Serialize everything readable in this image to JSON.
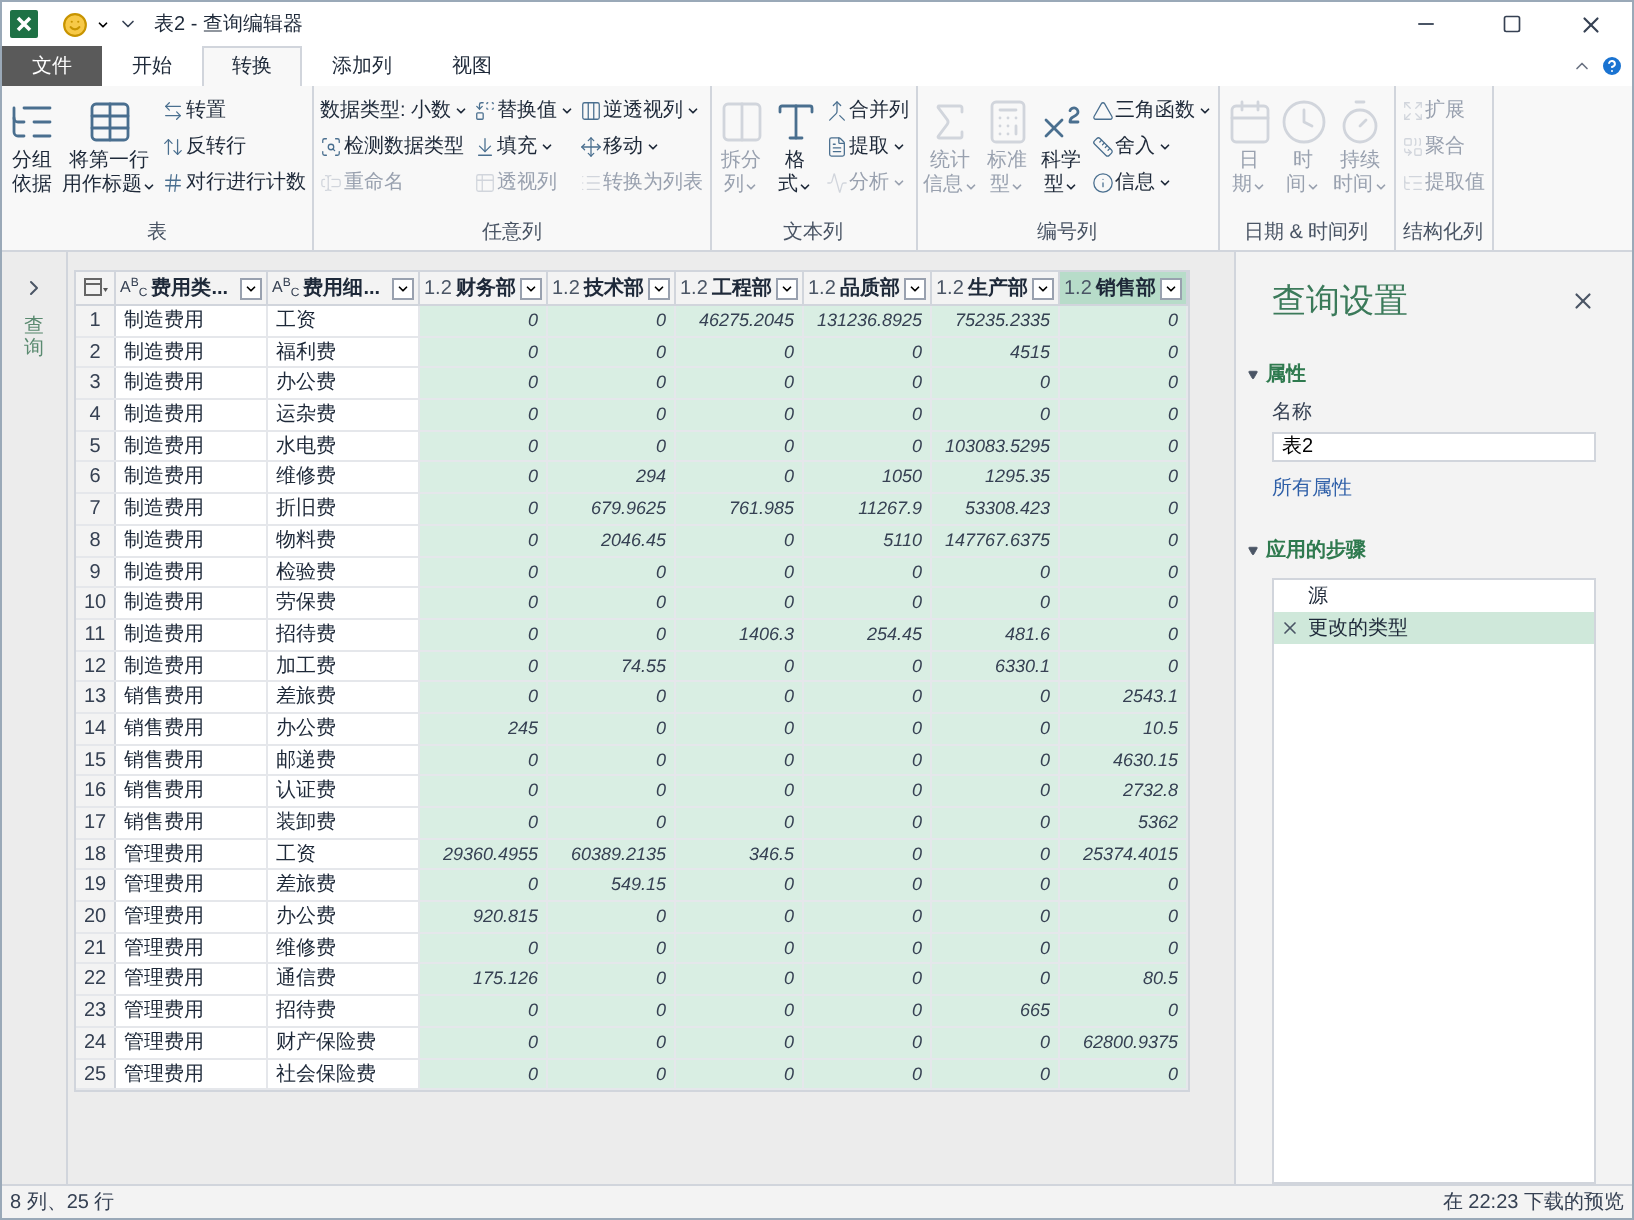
{
  "window": {
    "title": "表2 - 查询编辑器"
  },
  "menu_tabs": [
    {
      "label": "文件",
      "kind": "file",
      "selected": false
    },
    {
      "label": "开始",
      "kind": "tab",
      "selected": false
    },
    {
      "label": "转换",
      "kind": "tab",
      "selected": true
    },
    {
      "label": "添加列",
      "kind": "tab",
      "selected": false
    },
    {
      "label": "视图",
      "kind": "tab",
      "selected": false
    }
  ],
  "ribbon": [
    {
      "label": "表",
      "columns": [
        {
          "kind": "large",
          "lines": [
            "分组",
            "依据"
          ],
          "dropdown": false,
          "disabled": false
        },
        {
          "kind": "large",
          "lines": [
            "将第一行",
            "用作标题"
          ],
          "dropdown": true,
          "disabled": false
        },
        {
          "kind": "stack",
          "buttons": [
            {
              "label": "转置",
              "dropdown": false,
              "disabled": false
            },
            {
              "label": "反转行",
              "dropdown": false,
              "disabled": false
            },
            {
              "label": "对行进行计数",
              "dropdown": false,
              "disabled": false
            }
          ]
        }
      ]
    },
    {
      "label": "任意列",
      "columns": [
        {
          "kind": "stack",
          "buttons": [
            {
              "label": "数据类型: 小数",
              "dropdown": true,
              "disabled": false
            },
            {
              "label": "检测数据类型",
              "dropdown": false,
              "disabled": false
            },
            {
              "label": "重命名",
              "dropdown": false,
              "disabled": true
            }
          ]
        },
        {
          "kind": "stack",
          "buttons": [
            {
              "label": "替换值",
              "dropdown": true,
              "disabled": false
            },
            {
              "label": "填充",
              "dropdown": true,
              "disabled": false
            },
            {
              "label": "透视列",
              "dropdown": false,
              "disabled": true
            }
          ]
        },
        {
          "kind": "stack",
          "buttons": [
            {
              "label": "逆透视列",
              "dropdown": true,
              "disabled": false
            },
            {
              "label": "移动",
              "dropdown": true,
              "disabled": false
            },
            {
              "label": "转换为列表",
              "dropdown": false,
              "disabled": true
            }
          ]
        }
      ]
    },
    {
      "label": "文本列",
      "columns": [
        {
          "kind": "large",
          "lines": [
            "拆分",
            "列"
          ],
          "dropdown": true,
          "disabled": true
        },
        {
          "kind": "large",
          "lines": [
            "格",
            "式"
          ],
          "dropdown": true,
          "disabled": false
        },
        {
          "kind": "stack",
          "buttons": [
            {
              "label": "合并列",
              "dropdown": false,
              "disabled": false
            },
            {
              "label": "提取",
              "dropdown": true,
              "disabled": false
            },
            {
              "label": "分析",
              "dropdown": true,
              "disabled": true
            }
          ]
        }
      ]
    },
    {
      "label": "编号列",
      "columns": [
        {
          "kind": "large",
          "lines": [
            "统计",
            "信息"
          ],
          "dropdown": true,
          "disabled": true
        },
        {
          "kind": "large",
          "lines": [
            "标准",
            "型"
          ],
          "dropdown": true,
          "disabled": true
        },
        {
          "kind": "large",
          "lines": [
            "科学",
            "型"
          ],
          "dropdown": true,
          "disabled": false
        },
        {
          "kind": "stack",
          "buttons": [
            {
              "label": "三角函数",
              "dropdown": true,
              "disabled": false
            },
            {
              "label": "舍入",
              "dropdown": true,
              "disabled": false
            },
            {
              "label": "信息",
              "dropdown": true,
              "disabled": false
            }
          ]
        }
      ]
    },
    {
      "label": "日期 & 时间列",
      "columns": [
        {
          "kind": "large",
          "lines": [
            "日",
            "期"
          ],
          "dropdown": true,
          "disabled": true
        },
        {
          "kind": "large",
          "lines": [
            "时",
            "间"
          ],
          "dropdown": true,
          "disabled": true
        },
        {
          "kind": "large",
          "lines": [
            "持续",
            "时间"
          ],
          "dropdown": true,
          "disabled": true
        }
      ]
    },
    {
      "label": "结构化列",
      "columns": [
        {
          "kind": "stack",
          "buttons": [
            {
              "label": "扩展",
              "dropdown": false,
              "disabled": true
            },
            {
              "label": "聚合",
              "dropdown": false,
              "disabled": true
            },
            {
              "label": "提取值",
              "dropdown": false,
              "disabled": true
            }
          ]
        }
      ]
    }
  ],
  "navigator": {
    "label": "查询"
  },
  "table": {
    "columns": [
      {
        "name": "费用类...",
        "kind": "text",
        "type_label": "A$^{B}$$_{C}$",
        "selected": false
      },
      {
        "name": "费用细...",
        "kind": "text",
        "type_label": "A$^{B}$$_{C}$",
        "selected": false
      },
      {
        "name": "财务部",
        "kind": "decimal",
        "type_label": "1.2",
        "selected": false
      },
      {
        "name": "技术部",
        "kind": "decimal",
        "type_label": "1.2",
        "selected": false
      },
      {
        "name": "工程部",
        "kind": "decimal",
        "type_label": "1.2",
        "selected": false
      },
      {
        "name": "品质部",
        "kind": "decimal",
        "type_label": "1.2",
        "selected": false
      },
      {
        "name": "生产部",
        "kind": "decimal",
        "type_label": "1.2",
        "selected": false
      },
      {
        "name": "销售部",
        "kind": "decimal",
        "type_label": "1.2",
        "selected": true
      }
    ],
    "rows": [
      {
        "num": "1",
        "cells": [
          "制造费用",
          "工资",
          "0",
          "0",
          "46275.2045",
          "131236.8925",
          "75235.2335",
          "0"
        ]
      },
      {
        "num": "2",
        "cells": [
          "制造费用",
          "福利费",
          "0",
          "0",
          "0",
          "0",
          "4515",
          "0"
        ]
      },
      {
        "num": "3",
        "cells": [
          "制造费用",
          "办公费",
          "0",
          "0",
          "0",
          "0",
          "0",
          "0"
        ]
      },
      {
        "num": "4",
        "cells": [
          "制造费用",
          "运杂费",
          "0",
          "0",
          "0",
          "0",
          "0",
          "0"
        ]
      },
      {
        "num": "5",
        "cells": [
          "制造费用",
          "水电费",
          "0",
          "0",
          "0",
          "0",
          "103083.5295",
          "0"
        ]
      },
      {
        "num": "6",
        "cells": [
          "制造费用",
          "维修费",
          "0",
          "294",
          "0",
          "1050",
          "1295.35",
          "0"
        ]
      },
      {
        "num": "7",
        "cells": [
          "制造费用",
          "折旧费",
          "0",
          "679.9625",
          "761.985",
          "11267.9",
          "53308.423",
          "0"
        ]
      },
      {
        "num": "8",
        "cells": [
          "制造费用",
          "物料费",
          "0",
          "2046.45",
          "0",
          "5110",
          "147767.6375",
          "0"
        ]
      },
      {
        "num": "9",
        "cells": [
          "制造费用",
          "检验费",
          "0",
          "0",
          "0",
          "0",
          "0",
          "0"
        ]
      },
      {
        "num": "10",
        "cells": [
          "制造费用",
          "劳保费",
          "0",
          "0",
          "0",
          "0",
          "0",
          "0"
        ]
      },
      {
        "num": "11",
        "cells": [
          "制造费用",
          "招待费",
          "0",
          "0",
          "1406.3",
          "254.45",
          "481.6",
          "0"
        ]
      },
      {
        "num": "12",
        "cells": [
          "制造费用",
          "加工费",
          "0",
          "74.55",
          "0",
          "0",
          "6330.1",
          "0"
        ]
      },
      {
        "num": "13",
        "cells": [
          "销售费用",
          "差旅费",
          "0",
          "0",
          "0",
          "0",
          "0",
          "2543.1"
        ]
      },
      {
        "num": "14",
        "cells": [
          "销售费用",
          "办公费",
          "245",
          "0",
          "0",
          "0",
          "0",
          "10.5"
        ]
      },
      {
        "num": "15",
        "cells": [
          "销售费用",
          "邮递费",
          "0",
          "0",
          "0",
          "0",
          "0",
          "4630.15"
        ]
      },
      {
        "num": "16",
        "cells": [
          "销售费用",
          "认证费",
          "0",
          "0",
          "0",
          "0",
          "0",
          "2732.8"
        ]
      },
      {
        "num": "17",
        "cells": [
          "销售费用",
          "装卸费",
          "0",
          "0",
          "0",
          "0",
          "0",
          "5362"
        ]
      },
      {
        "num": "18",
        "cells": [
          "管理费用",
          "工资",
          "29360.4955",
          "60389.2135",
          "346.5",
          "0",
          "0",
          "25374.4015"
        ]
      },
      {
        "num": "19",
        "cells": [
          "管理费用",
          "差旅费",
          "0",
          "549.15",
          "0",
          "0",
          "0",
          "0"
        ]
      },
      {
        "num": "20",
        "cells": [
          "管理费用",
          "办公费",
          "920.815",
          "0",
          "0",
          "0",
          "0",
          "0"
        ]
      },
      {
        "num": "21",
        "cells": [
          "管理费用",
          "维修费",
          "0",
          "0",
          "0",
          "0",
          "0",
          "0"
        ]
      },
      {
        "num": "22",
        "cells": [
          "管理费用",
          "通信费",
          "175.126",
          "0",
          "0",
          "0",
          "0",
          "80.5"
        ]
      },
      {
        "num": "23",
        "cells": [
          "管理费用",
          "招待费",
          "0",
          "0",
          "0",
          "0",
          "665",
          "0"
        ]
      },
      {
        "num": "24",
        "cells": [
          "管理费用",
          "财产保险费",
          "0",
          "0",
          "0",
          "0",
          "0",
          "62800.9375"
        ]
      },
      {
        "num": "25",
        "cells": [
          "管理费用",
          "社会保险费",
          "0",
          "0",
          "0",
          "0",
          "0",
          "0"
        ]
      }
    ]
  },
  "query_settings": {
    "title": "查询设置",
    "properties_heading": "属性",
    "name_label": "名称",
    "name_value": "表2",
    "all_properties_link": "所有属性",
    "steps_heading": "应用的步骤",
    "steps": [
      {
        "label": "源",
        "selected": false
      },
      {
        "label": "更改的类型",
        "selected": true
      }
    ]
  },
  "status_bar": {
    "left": "8 列、25 行",
    "right": "在 22:23 下载的预览"
  }
}
